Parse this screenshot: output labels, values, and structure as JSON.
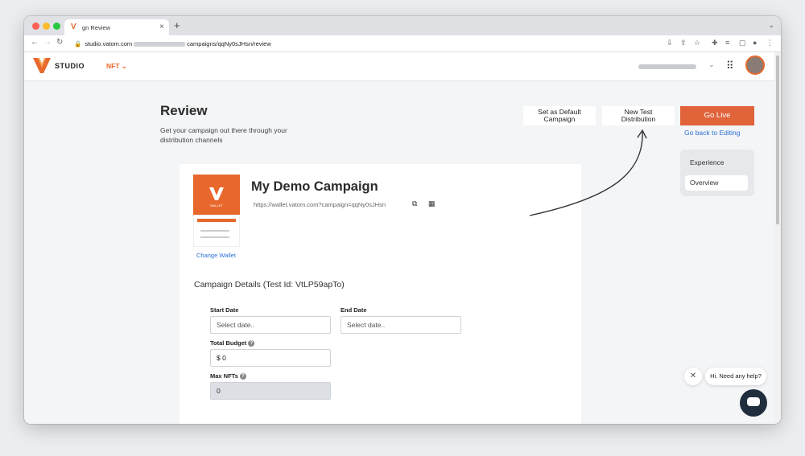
{
  "browser": {
    "tab_title": "gn Review",
    "new_tab_icon": "+",
    "url_prefix": "studio.vatom.com",
    "url_suffix": "campaigns/qqNy0sJHsn/review"
  },
  "header": {
    "logo_text": "STUDIO",
    "nav_menu": "NFT"
  },
  "page": {
    "title": "Review",
    "subtitle": "Get your campaign out there through your distribution channels"
  },
  "actions": {
    "set_default": "Set as Default Campaign",
    "new_test": "New Test Distribution",
    "go_live": "Go Live",
    "back_to_editing": "Go back to Editing"
  },
  "sidebar": {
    "items": [
      {
        "label": "Experience"
      },
      {
        "label": "Overview"
      }
    ]
  },
  "campaign": {
    "name": "My Demo Campaign",
    "url": "https://wallet.vatom.com?campaign=qqNy0sJHsn",
    "change_wallet": "Change Wallet",
    "wallet_label": "WALLET"
  },
  "details": {
    "title": "Campaign Details (Test Id: VtLP59apTo)",
    "start_date": {
      "label": "Start Date",
      "placeholder": "Select date.."
    },
    "end_date": {
      "label": "End Date",
      "placeholder": "Select date.."
    },
    "total_budget": {
      "label": "Total Budget",
      "value": "$ 0"
    },
    "max_nfts": {
      "label": "Max NFTs",
      "value": "0"
    }
  },
  "chat": {
    "greeting": "Hi. Need any help?"
  },
  "colors": {
    "accent": "#e0633a",
    "link": "#2a6fd6",
    "chat_button": "#1f2d3d"
  }
}
